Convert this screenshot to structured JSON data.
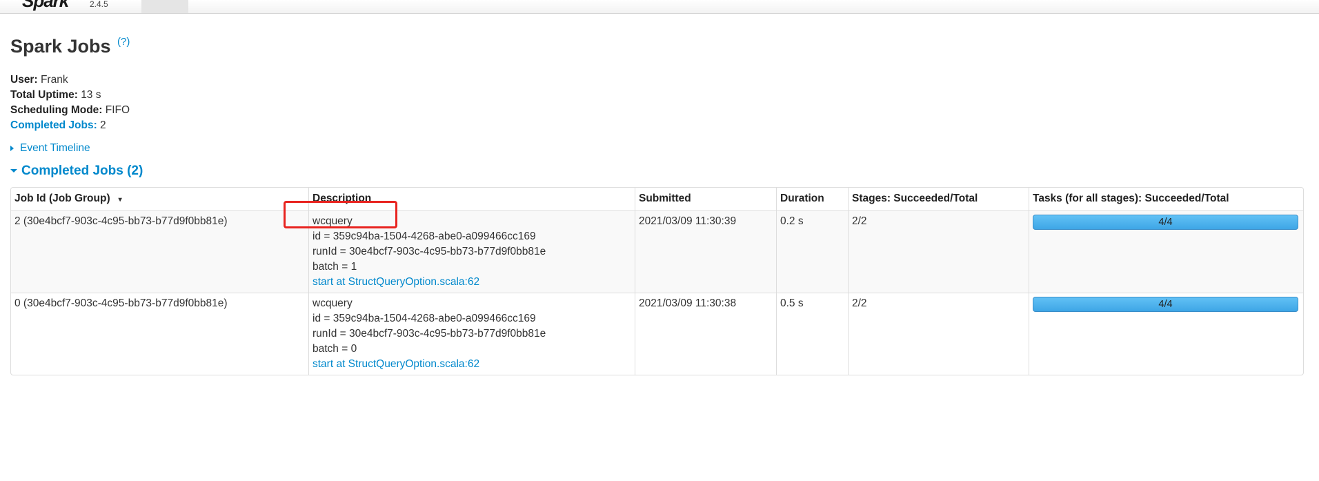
{
  "navbar": {
    "brand": "Spark",
    "version": "2.4.5"
  },
  "page": {
    "title": "Spark Jobs",
    "help": "(?)"
  },
  "summary": {
    "user_label": "User:",
    "user_value": "Frank",
    "uptime_label": "Total Uptime:",
    "uptime_value": "13 s",
    "mode_label": "Scheduling Mode:",
    "mode_value": "FIFO",
    "completed_label": "Completed Jobs:",
    "completed_value": "2"
  },
  "timeline": {
    "label": "Event Timeline"
  },
  "section": {
    "title": "Completed Jobs (2)"
  },
  "table": {
    "headers": {
      "job_id": "Job Id (Job Group)",
      "description": "Description",
      "submitted": "Submitted",
      "duration": "Duration",
      "stages": "Stages: Succeeded/Total",
      "tasks": "Tasks (for all stages): Succeeded/Total"
    },
    "sort_indicator": "▾",
    "rows": [
      {
        "job_id": "2 (30e4bcf7-903c-4c95-bb73-b77d9f0bb81e)",
        "desc_name": "wcquery",
        "desc_id": "id = 359c94ba-1504-4268-abe0-a099466cc169",
        "desc_runid": "runId = 30e4bcf7-903c-4c95-bb73-b77d9f0bb81e",
        "desc_batch": "batch = 1",
        "desc_link": "start at StructQueryOption.scala:62",
        "submitted": "2021/03/09 11:30:39",
        "duration": "0.2 s",
        "stages": "2/2",
        "tasks": "4/4",
        "tasks_fraction": 1.0
      },
      {
        "job_id": "0 (30e4bcf7-903c-4c95-bb73-b77d9f0bb81e)",
        "desc_name": "wcquery",
        "desc_id": "id = 359c94ba-1504-4268-abe0-a099466cc169",
        "desc_runid": "runId = 30e4bcf7-903c-4c95-bb73-b77d9f0bb81e",
        "desc_batch": "batch = 0",
        "desc_link": "start at StructQueryOption.scala:62",
        "submitted": "2021/03/09 11:30:38",
        "duration": "0.5 s",
        "stages": "2/2",
        "tasks": "4/4",
        "tasks_fraction": 1.0
      }
    ]
  },
  "colors": {
    "link": "#0088cc",
    "progress": "#3ea6e6",
    "annotation": "#e8231f"
  }
}
